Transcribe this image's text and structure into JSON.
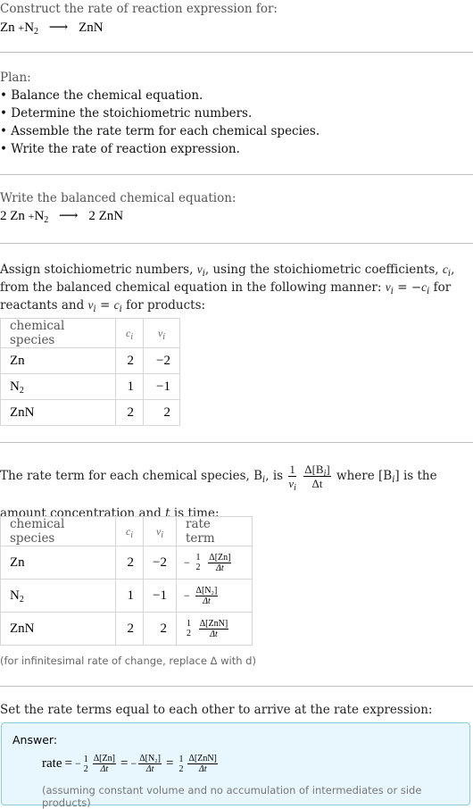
{
  "header": {
    "intro": "Construct the rate of reaction expression for:",
    "reaction": {
      "reactant1": "Zn",
      "plus": "+",
      "reactant2_base": "N",
      "reactant2_sub": "2",
      "arrow": "⟶",
      "product": "ZnN"
    }
  },
  "plan": {
    "title": "Plan:",
    "items": [
      "• Balance the chemical equation.",
      "• Determine the stoichiometric numbers.",
      "• Assemble the rate term for each chemical species.",
      "• Write the rate of reaction expression."
    ]
  },
  "balanced": {
    "intro": "Write the balanced chemical equation:",
    "coef1": "2",
    "reactant1": "Zn",
    "plus": "+",
    "reactant2_base": "N",
    "reactant2_sub": "2",
    "arrow": "⟶",
    "coef3": "2",
    "product": "ZnN"
  },
  "stoich": {
    "text1": "Assign stoichiometric numbers, ",
    "nu": "ν",
    "i": "i",
    "text2": ", using the stoichiometric coefficients, ",
    "c": "c",
    "text3": ", from the balanced chemical equation in the following manner: ",
    "text4": " = −",
    "text5": " for reactants and ",
    "text6": " = ",
    "text7": " for products:",
    "table": {
      "headers": [
        "chemical species",
        "c",
        "ν"
      ],
      "rows": [
        {
          "species": "Zn",
          "species_sub": "",
          "c": "2",
          "nu": "−2"
        },
        {
          "species": "N",
          "species_sub": "2",
          "c": "1",
          "nu": "−1"
        },
        {
          "species": "ZnN",
          "species_sub": "",
          "c": "2",
          "nu": "2"
        }
      ]
    }
  },
  "rateterm": {
    "text1": "The rate term for each chemical species, B",
    "text2": ", is ",
    "frac_num1": "1",
    "frac_den1": "ν",
    "frac_num2": "Δ[B",
    "frac_num2_end": "]",
    "frac_den2": "Δt",
    "text3": " where [B",
    "text4": "] is the amount concentration and ",
    "t": "t",
    "text5": " is time:",
    "table": {
      "headers": [
        "chemical species",
        "c",
        "ν",
        "rate term"
      ],
      "rows": [
        {
          "species": "Zn",
          "species_sub": "",
          "c": "2",
          "nu": "−2",
          "sign": "−",
          "coef_num": "1",
          "coef_den": "2",
          "delta": "Δ[Zn]",
          "dt": "Δt"
        },
        {
          "species": "N",
          "species_sub": "2",
          "c": "1",
          "nu": "−1",
          "sign": "−",
          "coef_num": "",
          "coef_den": "",
          "delta": "Δ[N₂]",
          "dt": "Δt"
        },
        {
          "species": "ZnN",
          "species_sub": "",
          "c": "2",
          "nu": "2",
          "sign": "",
          "coef_num": "1",
          "coef_den": "2",
          "delta": "Δ[ZnN]",
          "dt": "Δt"
        }
      ]
    },
    "note": "(for infinitesimal rate of change, replace Δ with d)"
  },
  "final": {
    "intro": "Set the rate terms equal to each other to arrive at the rate expression:",
    "answer_label": "Answer:",
    "rate_word": "rate",
    "eq": "=",
    "minus": "−",
    "half_num": "1",
    "half_den": "2",
    "zn_delta": "Δ[Zn]",
    "n2_delta": "Δ[N₂]",
    "znn_delta": "Δ[ZnN]",
    "dt": "Δt",
    "note": "(assuming constant volume and no accumulation of intermediates or side products)"
  },
  "colors": {
    "answer_bg": "#e8f7fd",
    "answer_border": "#8ccbdc",
    "divider": "#bdbdbd",
    "muted_text": "#555555"
  }
}
